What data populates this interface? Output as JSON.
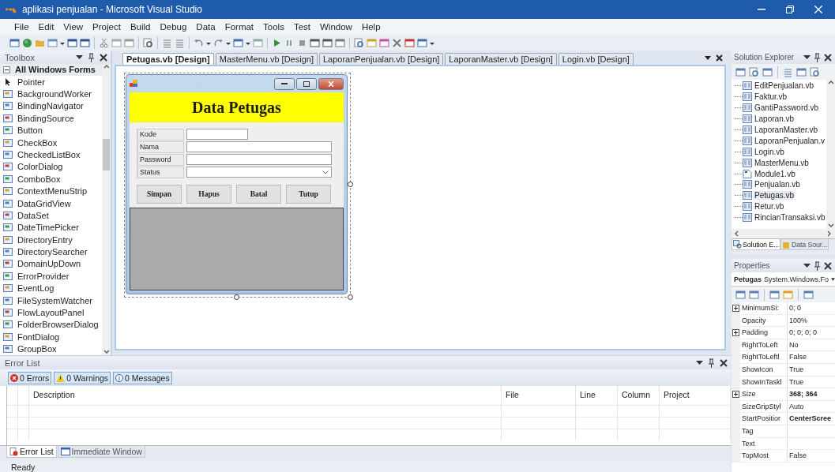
{
  "window": {
    "title": "aplikasi penjualan - Microsoft Visual Studio"
  },
  "menu": [
    "File",
    "Edit",
    "View",
    "Project",
    "Build",
    "Debug",
    "Data",
    "Format",
    "Tools",
    "Test",
    "Window",
    "Help"
  ],
  "toolbox": {
    "title": "Toolbox",
    "group": "All Windows Forms",
    "items": [
      "Pointer",
      "BackgroundWorker",
      "BindingNavigator",
      "BindingSource",
      "Button",
      "CheckBox",
      "CheckedListBox",
      "ColorDialog",
      "ComboBox",
      "ContextMenuStrip",
      "DataGridView",
      "DataSet",
      "DateTimePicker",
      "DirectoryEntry",
      "DirectorySearcher",
      "DomainUpDown",
      "ErrorProvider",
      "EventLog",
      "FileSystemWatcher",
      "FlowLayoutPanel",
      "FolderBrowserDialog",
      "FontDialog",
      "GroupBox"
    ]
  },
  "document_tabs": [
    {
      "label": "Petugas.vb [Design]",
      "selected": true
    },
    {
      "label": "MasterMenu.vb [Design]",
      "selected": false
    },
    {
      "label": "LaporanPenjualan.vb [Design]",
      "selected": false
    },
    {
      "label": "LaporanMaster.vb [Design]",
      "selected": false
    },
    {
      "label": "Login.vb [Design]",
      "selected": false
    }
  ],
  "designer_form": {
    "heading": "Data Petugas",
    "fields": [
      {
        "label": "Kode",
        "kind": "short"
      },
      {
        "label": "Nama",
        "kind": "text"
      },
      {
        "label": "Password",
        "kind": "text"
      },
      {
        "label": "Status",
        "kind": "combo"
      }
    ],
    "buttons": [
      "Simpan",
      "Hapus",
      "Batal",
      "Tutup"
    ]
  },
  "error_list": {
    "title": "Error List",
    "filters": [
      "0 Errors",
      "0 Warnings",
      "0 Messages"
    ],
    "columns": [
      "Description",
      "File",
      "Line",
      "Column",
      "Project"
    ],
    "tabs": [
      {
        "label": "Error List",
        "selected": true
      },
      {
        "label": "Immediate Window",
        "selected": false
      }
    ]
  },
  "solution_explorer": {
    "title": "Solution Explorer",
    "items": [
      {
        "label": "EditPenjualan.vb",
        "kind": "form",
        "selected": false
      },
      {
        "label": "Faktur.vb",
        "kind": "form",
        "selected": false
      },
      {
        "label": "GantiPassword.vb",
        "kind": "form",
        "selected": false
      },
      {
        "label": "Laporan.vb",
        "kind": "form",
        "selected": false
      },
      {
        "label": "LaporanMaster.vb",
        "kind": "form",
        "selected": false
      },
      {
        "label": "LaporanPenjualan.v",
        "kind": "form",
        "selected": false
      },
      {
        "label": "Login.vb",
        "kind": "form",
        "selected": false
      },
      {
        "label": "MasterMenu.vb",
        "kind": "form",
        "selected": false
      },
      {
        "label": "Module1.vb",
        "kind": "module",
        "selected": false
      },
      {
        "label": "Penjualan.vb",
        "kind": "form",
        "selected": false
      },
      {
        "label": "Petugas.vb",
        "kind": "form",
        "selected": true
      },
      {
        "label": "Retur.vb",
        "kind": "form",
        "selected": false
      },
      {
        "label": "RincianTransaksi.vb",
        "kind": "form",
        "selected": false
      }
    ],
    "tabs": [
      {
        "label": "Solution E...",
        "selected": true
      },
      {
        "label": "Data Sour...",
        "selected": false
      }
    ]
  },
  "properties": {
    "title": "Properties",
    "object_name": "Petugas",
    "object_type": "System.Windows.Fo",
    "rows": [
      {
        "name": "MinimumSi:",
        "value": "0; 0",
        "expandable": true,
        "bold": false
      },
      {
        "name": "Opacity",
        "value": "100%",
        "expandable": false,
        "bold": false
      },
      {
        "name": "Padding",
        "value": "0; 0; 0; 0",
        "expandable": true,
        "bold": false
      },
      {
        "name": "RightToLeft",
        "value": "No",
        "expandable": false,
        "bold": false
      },
      {
        "name": "RightToLeftl",
        "value": "False",
        "expandable": false,
        "bold": false
      },
      {
        "name": "ShowIcon",
        "value": "True",
        "expandable": false,
        "bold": false
      },
      {
        "name": "ShowInTaskl",
        "value": "True",
        "expandable": false,
        "bold": false
      },
      {
        "name": "Size",
        "value": "368; 364",
        "expandable": true,
        "bold": true
      },
      {
        "name": "SizeGripStyl",
        "value": "Auto",
        "expandable": false,
        "bold": false
      },
      {
        "name": "StartPositior",
        "value": "CenterScree",
        "expandable": false,
        "bold": true
      },
      {
        "name": "Tag",
        "expandable": false
      },
      {
        "name": "Text",
        "expandable": false
      },
      {
        "name": "TopMost",
        "value": "False",
        "expandable": false,
        "bold": false
      }
    ]
  },
  "status_bar": "Ready"
}
